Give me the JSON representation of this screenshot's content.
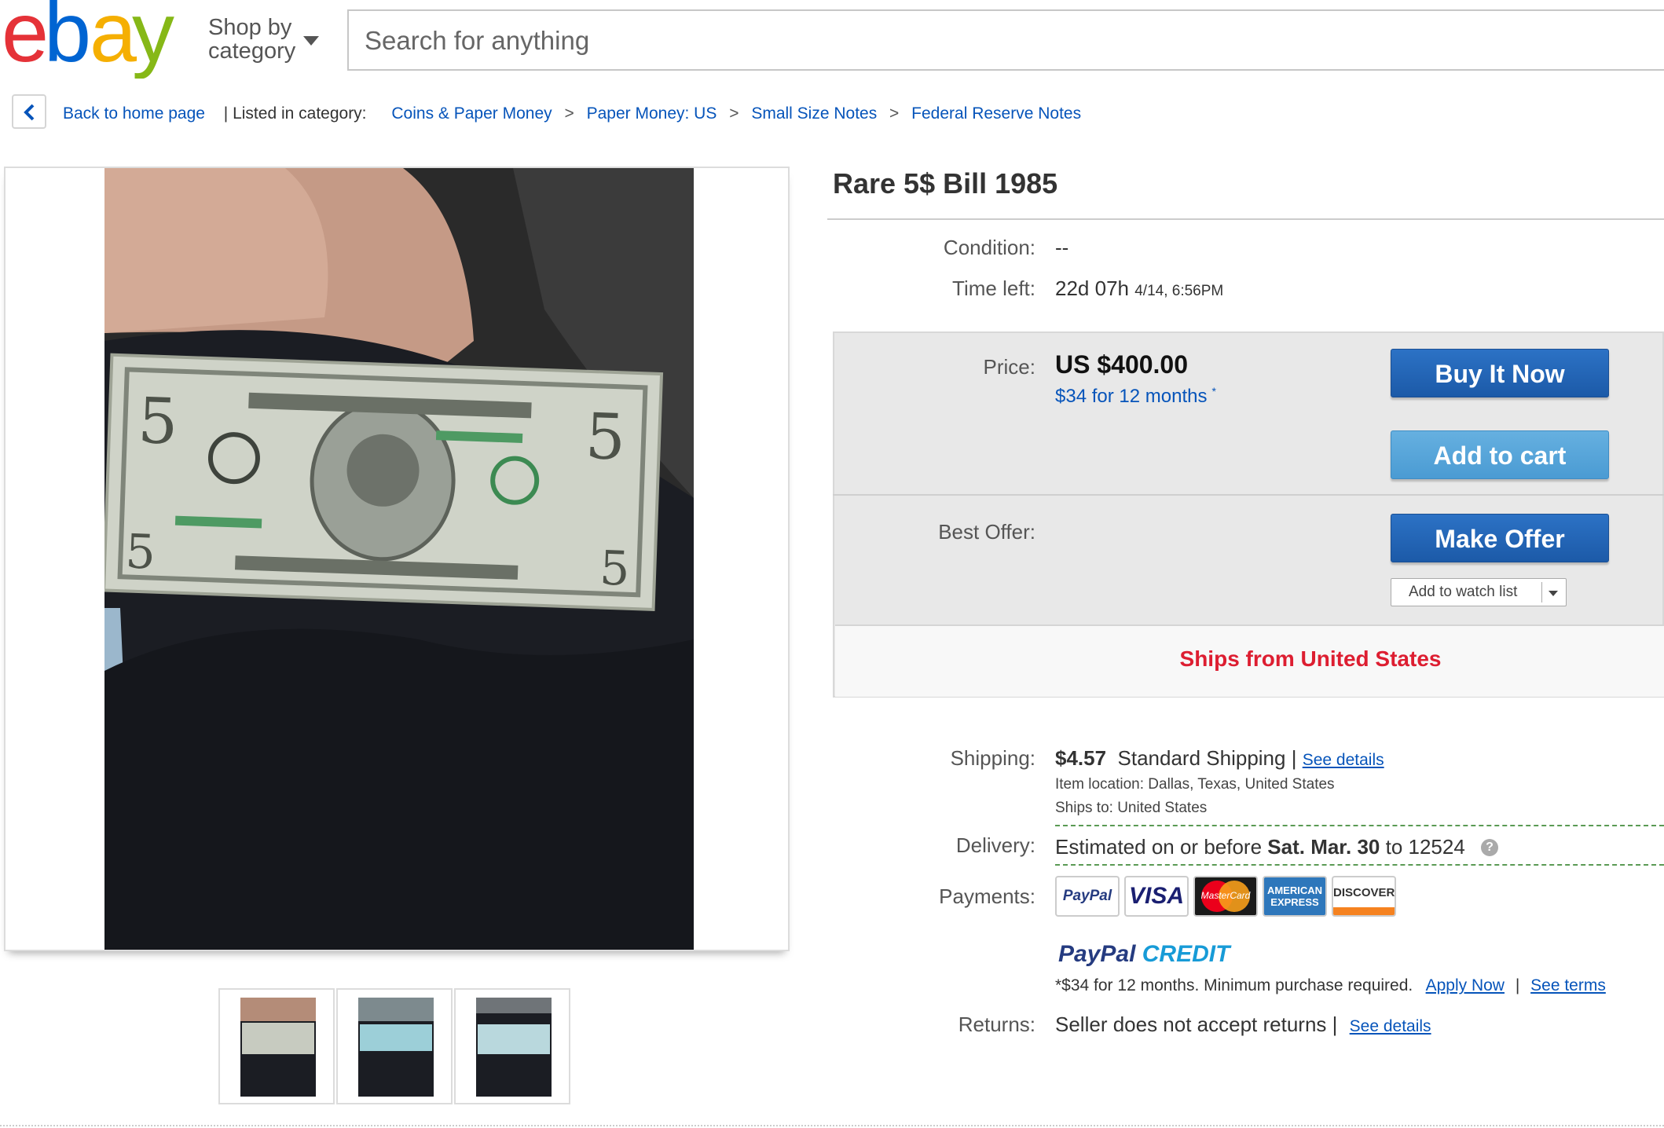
{
  "header": {
    "logo_letters": [
      "e",
      "b",
      "a",
      "y"
    ],
    "logo_colors": [
      "#e53238",
      "#0064d2",
      "#f5af02",
      "#86b817"
    ],
    "shop_by_line1": "Shop by",
    "shop_by_line2": "category",
    "search_placeholder": "Search for anything"
  },
  "breadcrumb": {
    "back_label": "Back to home page",
    "listed_in": "| Listed in category:",
    "items": [
      "Coins & Paper Money",
      "Paper Money: US",
      "Small Size Notes",
      "Federal Reserve Notes"
    ],
    "separator": ">"
  },
  "item": {
    "title": "Rare 5$ Bill 1985",
    "condition_label": "Condition:",
    "condition_value": "--",
    "time_left_label": "Time left:",
    "time_left_value": "22d 07h",
    "time_left_end": "4/14, 6:56PM",
    "price_label": "Price:",
    "price_value": "US $400.00",
    "financing": "$34 for 12 months",
    "financing_mark": "*",
    "best_offer_label": "Best Offer:",
    "buy_now": "Buy It Now",
    "add_to_cart": "Add to cart",
    "make_offer": "Make Offer",
    "watch_list": "Add to watch list",
    "ships_from": "Ships from United States"
  },
  "shipping": {
    "label": "Shipping:",
    "cost": "$4.57",
    "method": "Standard Shipping",
    "divider": "|",
    "details_link": "See details",
    "item_location": "Item location:  Dallas, Texas, United States",
    "ships_to": "Ships to:  United States"
  },
  "delivery": {
    "label": "Delivery:",
    "prefix": "Estimated on or before",
    "date": "Sat. Mar. 30",
    "suffix": "to 12524",
    "help": "?"
  },
  "payments": {
    "label": "Payments:",
    "paypal": "PayPal",
    "visa": "VISA",
    "mastercard": "MasterCard",
    "amex_line1": "AMERICAN",
    "amex_line2": "EXPRESS",
    "discover": "DISCOVER",
    "credit_brand_1": "PayPal",
    "credit_brand_2": "CREDIT",
    "credit_note": "*$34 for 12 months. Minimum purchase required.",
    "apply_now": "Apply Now",
    "see_terms": "See terms",
    "link_divider": "|"
  },
  "returns": {
    "label": "Returns:",
    "value": "Seller does not accept returns",
    "divider": "|",
    "details_link": "See details"
  },
  "colors": {
    "link": "#0654ba",
    "ships_red": "#dd1e31",
    "button_blue": "#1c5aa8",
    "button_light_blue": "#4a9bd3"
  }
}
